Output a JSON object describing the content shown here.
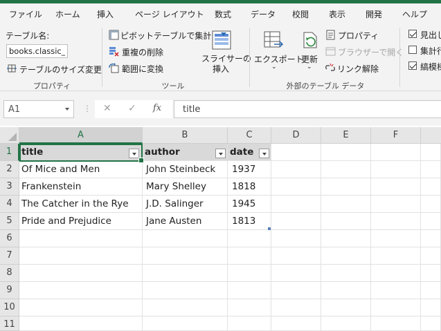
{
  "ribbon_tabs": [
    "ファイル",
    "ホーム",
    "挿入",
    "ページ レイアウト",
    "数式",
    "データ",
    "校閲",
    "表示",
    "開発",
    "ヘルプ"
  ],
  "ribbon": {
    "properties": {
      "table_name_label": "テーブル名:",
      "table_name_value": "books.classic_b",
      "resize_label": "テーブルのサイズ変更",
      "group_label": "プロパティ"
    },
    "tools": {
      "pivot_label": "ピボットテーブルで集計",
      "remove_dup_label": "重複の削除",
      "convert_label": "範囲に変換",
      "slicer_label_1": "スライサーの",
      "slicer_label_2": "挿入",
      "group_label": "ツール"
    },
    "external": {
      "export_label": "エクスポート",
      "refresh_label": "更新",
      "properties_label": "プロパティ",
      "browser_label": "ブラウザーで開く",
      "unlink_label": "リンク解除",
      "group_label": "外部のテーブル データ"
    },
    "style_options": {
      "header_row_label": "見出し",
      "total_row_label": "集計行",
      "banded_rows_label": "縞模様",
      "header_row_checked": true,
      "total_row_checked": false,
      "banded_rows_checked": true
    }
  },
  "formula_bar": {
    "name_box": "A1",
    "cancel": "✕",
    "enter": "✓",
    "fx": "fx",
    "content": "title"
  },
  "grid": {
    "columns": [
      "A",
      "B",
      "C",
      "D",
      "E",
      "F"
    ],
    "rows": [
      "1",
      "2",
      "3",
      "4",
      "5",
      "6",
      "7",
      "8",
      "9",
      "10",
      "11"
    ],
    "selected_column": "A",
    "selected_row": "1",
    "table_headers": [
      "title",
      "author",
      "date"
    ],
    "table_rows": [
      [
        "Of Mice and Men",
        "John Steinbeck",
        "1937"
      ],
      [
        "Frankenstein",
        "Mary Shelley",
        "1818"
      ],
      [
        "The Catcher in the Rye",
        "J.D. Salinger",
        "1945"
      ],
      [
        "Pride and Prejudice",
        "Jane Austen",
        "1813"
      ]
    ]
  },
  "colors": {
    "accent": "#217346",
    "header_fill": "#d9d9d9",
    "ribbon_bg": "#f3f3f3"
  }
}
